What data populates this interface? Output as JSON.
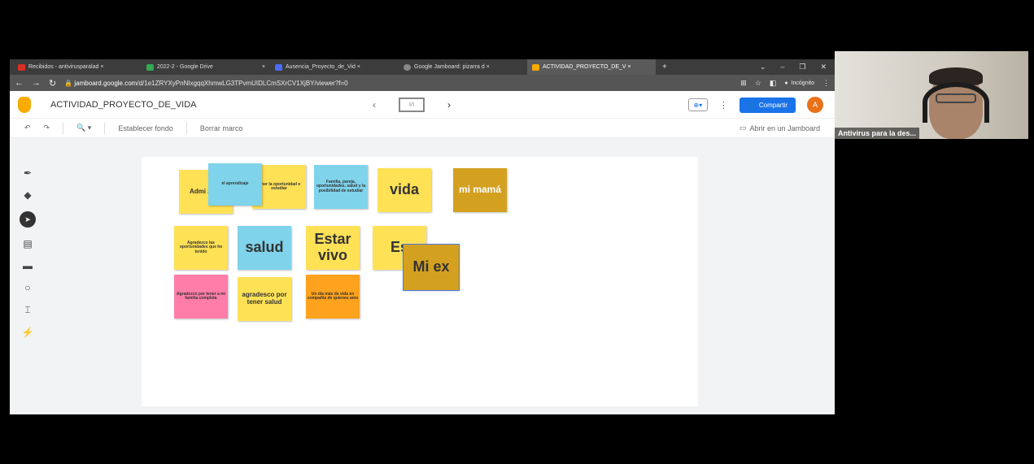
{
  "browser": {
    "tabs": [
      {
        "label": "Recibidos - antivirusparalad ×",
        "color": "#d93025"
      },
      {
        "label": "2022-2 - Google Drive",
        "color": "#34a853"
      },
      {
        "label": "Ausencia_Proyecto_de_Vid ×",
        "color": "#4a6cf7"
      },
      {
        "label": "Google Jamboard: pizarra d ×",
        "color": "#888888"
      },
      {
        "label": "ACTIVIDAD_PROYECTO_DE_V ×",
        "color": "#f9ab00"
      }
    ],
    "new_tab": "+",
    "url_host": "jamboard.google.com",
    "url_path": "/d/1e1ZRYXyPnNIxgqqXhmwLG3TPvmUIDLCmSXrCV1XjBY/viewer?f=0",
    "incognito_label": "Incógnito"
  },
  "app": {
    "title": "ACTIVIDAD_PROYECTO_DE_VIDA",
    "frame_label": "1/1",
    "share_label": "Compartir",
    "avatar_letter": "A"
  },
  "toolbar": {
    "set_background": "Establecer fondo",
    "clear_frame": "Borrar marco",
    "open_in_jamboard": "Abrir en un Jamboard"
  },
  "notes": {
    "n1": "Admi 2022",
    "n2": "el aprendizaje",
    "n3": "tener la oportunidad e estudiar",
    "n4": "Familia, pareja, oportunidades, salud y la posibilidad de estudiar",
    "n5": "vida",
    "n6": "mi mamá",
    "n7": "Agradezco las oportunidades que he tenido",
    "n8": "salud",
    "n9": "Estar vivo",
    "n10": "Es",
    "n11": "Mi ex",
    "n12": "Agradezco por tener a mi familia completa",
    "n13": "agradesco por tener salud",
    "n14": "Un día más de vida en compañía de quienes amo"
  },
  "camera": {
    "label": "Antivirus para la des..."
  }
}
